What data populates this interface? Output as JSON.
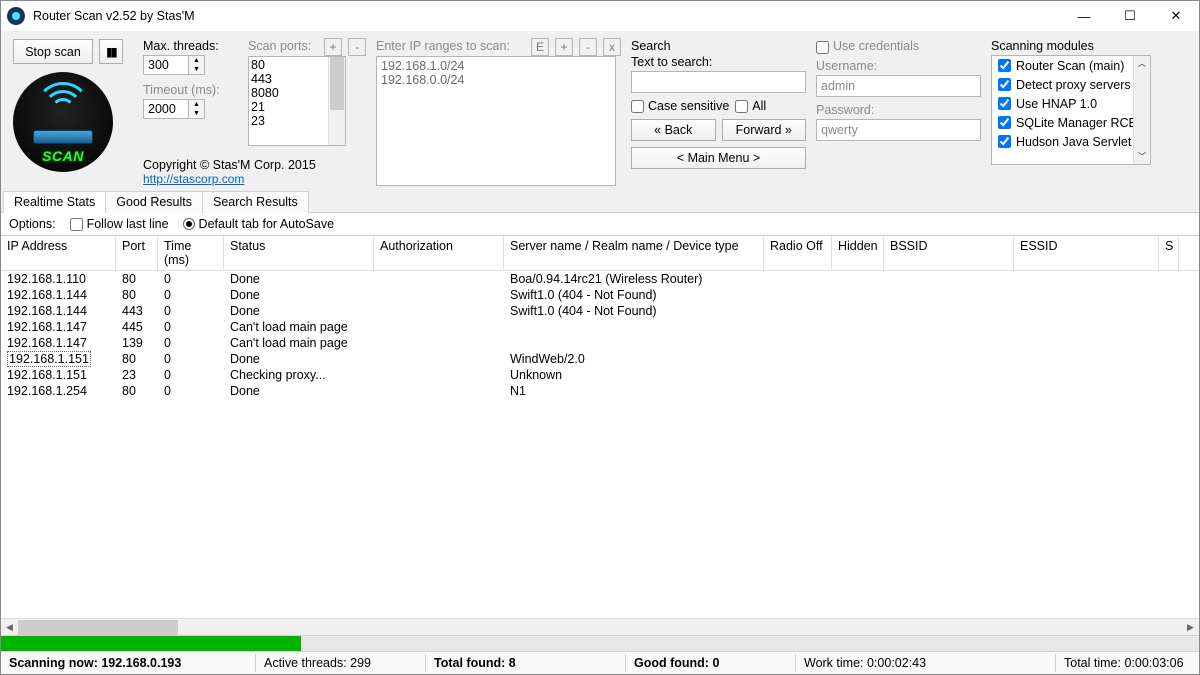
{
  "window": {
    "title": "Router Scan v2.52 by Stas'M"
  },
  "toolbar": {
    "stop_scan": "Stop scan",
    "pause_glyph": "▮▮",
    "max_threads_label": "Max. threads:",
    "max_threads_value": "300",
    "timeout_label": "Timeout (ms):",
    "timeout_value": "2000",
    "scan_ports_label": "Scan ports:",
    "ports": [
      "80",
      "443",
      "8080",
      "21",
      "23"
    ],
    "ip_ranges_label": "Enter IP ranges to scan:",
    "ip_ranges": [
      "192.168.1.0/24",
      "192.168.0.0/24"
    ],
    "btn_E": "E",
    "btn_plus": "+",
    "btn_minus": "-",
    "btn_X": "x",
    "copyright": "Copyright © Stas'M Corp. 2015",
    "website": "http://stascorp.com",
    "logo_text": "SCAN"
  },
  "search": {
    "title": "Search",
    "text_to_search_label": "Text to search:",
    "value": "",
    "case_sensitive": "Case sensitive",
    "all": "All",
    "back": "« Back",
    "forward": "Forward »",
    "main_menu": "< Main Menu >"
  },
  "credentials": {
    "use_label": "Use credentials",
    "username_label": "Username:",
    "username_value": "admin",
    "password_label": "Password:",
    "password_value": "qwerty"
  },
  "modules": {
    "title": "Scanning modules",
    "items": [
      "Router Scan (main)",
      "Detect proxy servers",
      "Use HNAP 1.0",
      "SQLite Manager RCE",
      "Hudson Java Servlet"
    ]
  },
  "tabs": [
    "Realtime Stats",
    "Good Results",
    "Search Results"
  ],
  "options": {
    "label": "Options:",
    "follow_last": "Follow last line",
    "default_tab": "Default tab for AutoSave"
  },
  "table": {
    "headers": {
      "ip": "IP Address",
      "port": "Port",
      "time": "Time (ms)",
      "status": "Status",
      "auth": "Authorization",
      "server": "Server name / Realm name / Device type",
      "radio": "Radio Off",
      "hidden": "Hidden",
      "bssid": "BSSID",
      "essid": "ESSID",
      "extra": "S"
    },
    "rows": [
      {
        "ip": "192.168.1.110",
        "port": "80",
        "time": "0",
        "status": "Done",
        "auth": "",
        "server": "Boa/0.94.14rc21 (Wireless Router)",
        "sel": false
      },
      {
        "ip": "192.168.1.144",
        "port": "80",
        "time": "0",
        "status": "Done",
        "auth": "",
        "server": "Swift1.0 (404 - Not Found)",
        "sel": false
      },
      {
        "ip": "192.168.1.144",
        "port": "443",
        "time": "0",
        "status": "Done",
        "auth": "",
        "server": "Swift1.0 (404 - Not Found)",
        "sel": false
      },
      {
        "ip": "192.168.1.147",
        "port": "445",
        "time": "0",
        "status": "Can't load main page",
        "auth": "",
        "server": "",
        "sel": false
      },
      {
        "ip": "192.168.1.147",
        "port": "139",
        "time": "0",
        "status": "Can't load main page",
        "auth": "",
        "server": "",
        "sel": false
      },
      {
        "ip": "192.168.1.151",
        "port": "80",
        "time": "0",
        "status": "Done",
        "auth": "",
        "server": "WindWeb/2.0",
        "sel": true
      },
      {
        "ip": "192.168.1.151",
        "port": "23",
        "time": "0",
        "status": "Checking proxy...",
        "auth": "",
        "server": "Unknown",
        "sel": false
      },
      {
        "ip": "192.168.1.254",
        "port": "80",
        "time": "0",
        "status": "Done",
        "auth": "",
        "server": "N1",
        "sel": false
      }
    ]
  },
  "status": {
    "scanning_label": "Scanning now: ",
    "scanning_ip": "192.168.0.193",
    "active_threads_label": "Active threads: ",
    "active_threads": "299",
    "total_found_label": "Total found: ",
    "total_found": "8",
    "good_found_label": "Good found: ",
    "good_found": "0",
    "work_time_label": "Work time: ",
    "work_time": "0:00:02:43",
    "total_time_label": "Total time: ",
    "total_time": "0:00:03:06"
  }
}
